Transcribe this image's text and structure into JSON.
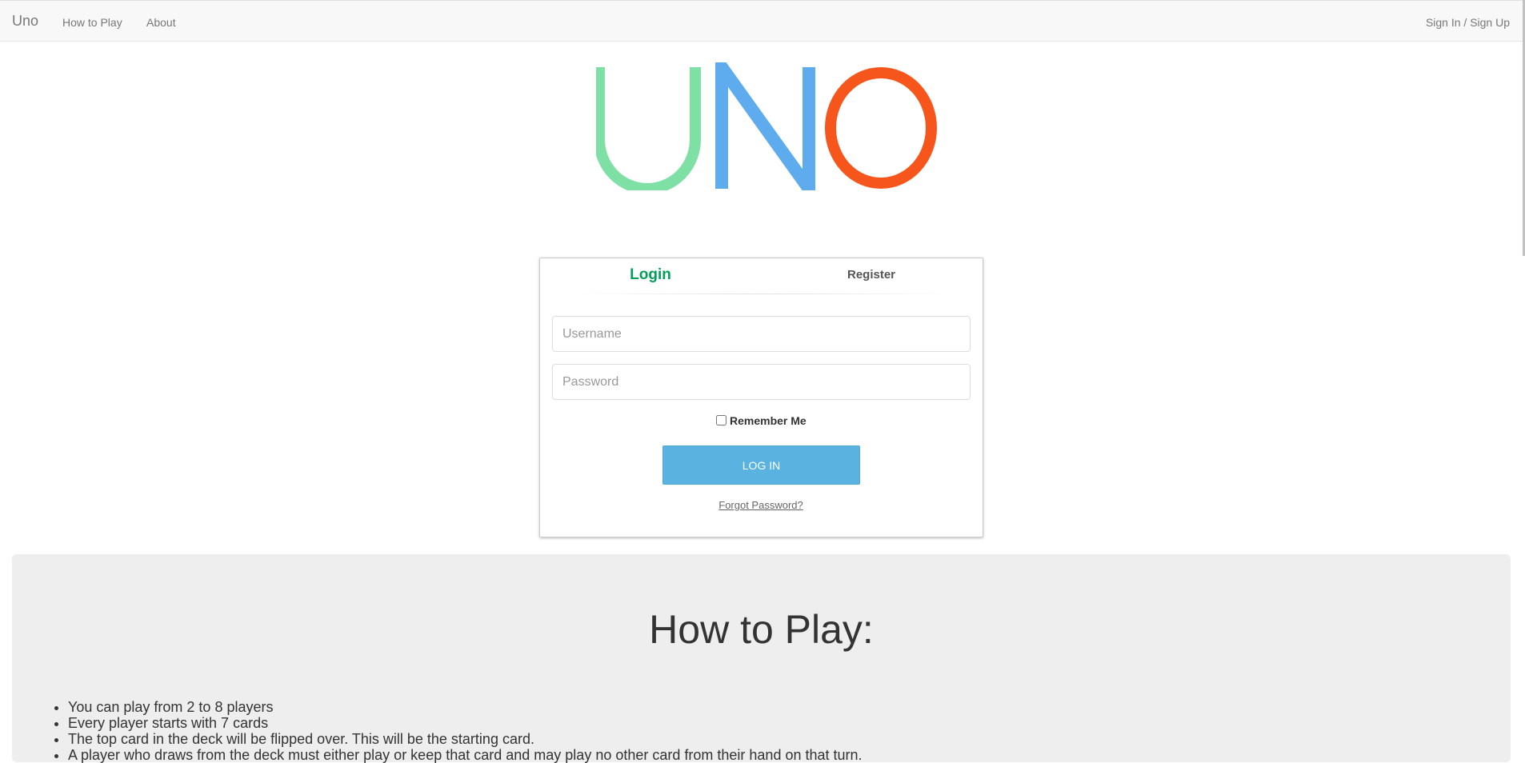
{
  "navbar": {
    "brand": "Uno",
    "links": [
      "How to Play",
      "About"
    ],
    "signin": "Sign In / Sign Up"
  },
  "logo": {
    "letters": [
      "U",
      "N",
      "O"
    ],
    "colors": [
      "#7fe0a6",
      "#5eacee",
      "#f6561b"
    ]
  },
  "login_card": {
    "tabs": {
      "login": "Login",
      "register": "Register"
    },
    "username_placeholder": "Username",
    "password_placeholder": "Password",
    "remember_label": "Remember Me",
    "login_button": "LOG IN",
    "forgot_link": "Forgot Password?"
  },
  "how_to_play": {
    "title": "How to Play:",
    "rules": [
      "You can play from 2 to 8 players",
      "Every player starts with 7 cards",
      "The top card in the deck will be flipped over. This will be the starting card.",
      "A player who draws from the deck must either play or keep that card and may play no other card from their hand on that turn."
    ]
  },
  "colors": {
    "accent": "#029f5b",
    "button": "#59b2e0",
    "panel": "#eeeeee"
  }
}
